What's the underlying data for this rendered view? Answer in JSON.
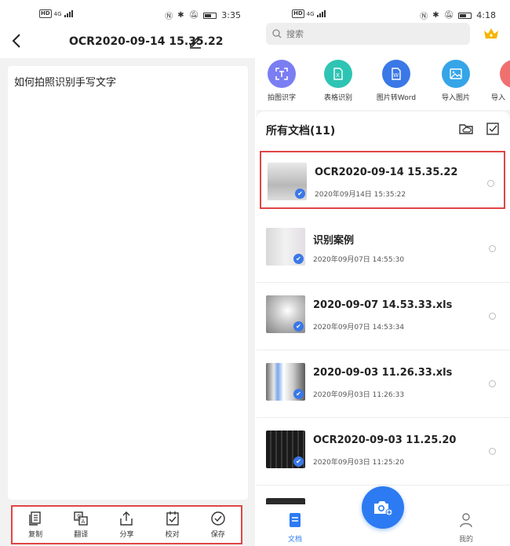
{
  "left_panel": {
    "status": {
      "time": "3:35",
      "network": "4G"
    },
    "header": {
      "title": "OCR2020-09-14 15.35.22"
    },
    "content": {
      "text": "如何拍照识别手写文字"
    },
    "toolbar": [
      {
        "label": "复制",
        "icon": "copy-icon"
      },
      {
        "label": "翻译",
        "icon": "translate-icon"
      },
      {
        "label": "分享",
        "icon": "share-icon"
      },
      {
        "label": "校对",
        "icon": "proofread-icon"
      },
      {
        "label": "保存",
        "icon": "save-icon"
      }
    ]
  },
  "right_panel": {
    "status": {
      "time": "4:18",
      "network": "4G"
    },
    "search": {
      "placeholder": "搜索"
    },
    "features": [
      {
        "label": "拍图识字",
        "color": "#7b7ef2"
      },
      {
        "label": "表格识别",
        "color": "#2ec4b3"
      },
      {
        "label": "图片转Word",
        "color": "#3b78e7"
      },
      {
        "label": "导入图片",
        "color": "#35a5e8"
      },
      {
        "label": "导入",
        "color": "#f07070"
      }
    ],
    "list": {
      "heading": "所有文档(11)",
      "items": [
        {
          "name": "OCR2020-09-14 15.35.22",
          "date": "2020年09月14日 15:35:22"
        },
        {
          "name": "识别案例",
          "date": "2020年09月07日 14:55:30"
        },
        {
          "name": "2020-09-07 14.53.33.xls",
          "date": "2020年09月07日 14:53:34"
        },
        {
          "name": "2020-09-03 11.26.33.xls",
          "date": "2020年09月03日 11:26:33"
        },
        {
          "name": "OCR2020-09-03 11.25.20",
          "date": "2020年09月03日 11:25:20"
        }
      ]
    },
    "bottom_nav": {
      "docs_label": "文档",
      "me_label": "我的"
    },
    "colors": {
      "accent": "#2d7bf2",
      "highlight": "#e04545"
    }
  }
}
